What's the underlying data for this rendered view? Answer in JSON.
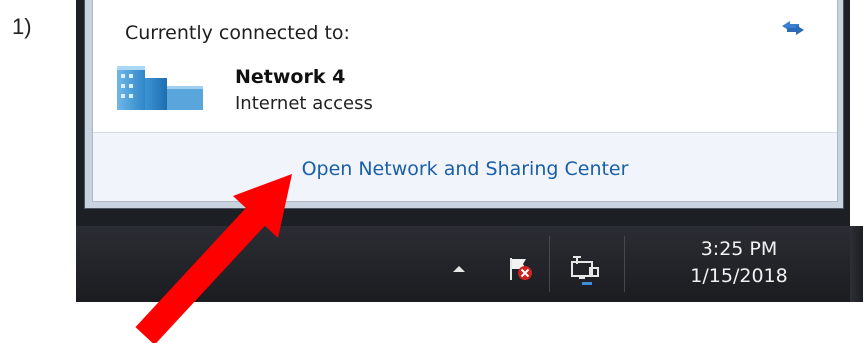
{
  "step": {
    "label": "1)"
  },
  "popup": {
    "connected_label": "Currently connected to:",
    "network": {
      "name": "Network  4",
      "status": "Internet access"
    },
    "footer_link": "Open Network and Sharing Center"
  },
  "taskbar": {
    "clock": {
      "time": "3:25 PM",
      "date": "1/15/2018"
    }
  },
  "colors": {
    "link": "#1a5ea8",
    "arrow": "#ff0000",
    "taskbar": "#1c1f24"
  },
  "icons": [
    "refresh-icon",
    "network-icon",
    "tray-arrow-icon",
    "action-center-flag-icon",
    "network-tray-icon"
  ]
}
